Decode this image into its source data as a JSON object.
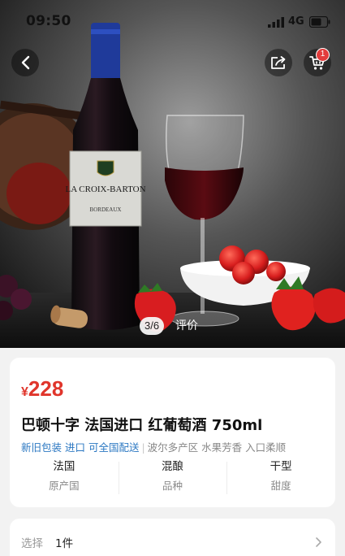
{
  "status_bar": {
    "time": "09:50",
    "network": "4G"
  },
  "header": {
    "cart_badge": "1"
  },
  "gallery": {
    "pager": "3/6",
    "review_tab": "评价"
  },
  "product": {
    "price_currency": "¥",
    "price_value": "228",
    "title": "巴顿十字 法国进口 红葡萄酒 750ml",
    "tags_blue": "新旧包装 进口 可全国配送",
    "tag_separator": "|",
    "tags_gray": "波尔多产区 水果芳香 入口柔顺",
    "specs": [
      {
        "value": "法国",
        "label": "原产国"
      },
      {
        "value": "混酿",
        "label": "品种"
      },
      {
        "value": "干型",
        "label": "甜度"
      }
    ]
  },
  "bottle_label": {
    "brand": "LA CROIX-BARTON",
    "region": "BORDEAUX"
  },
  "select": {
    "label": "选择",
    "value": "1件"
  },
  "colors": {
    "price": "#e0352b",
    "tag_blue": "#2c78c2",
    "badge": "#e23c3c"
  }
}
